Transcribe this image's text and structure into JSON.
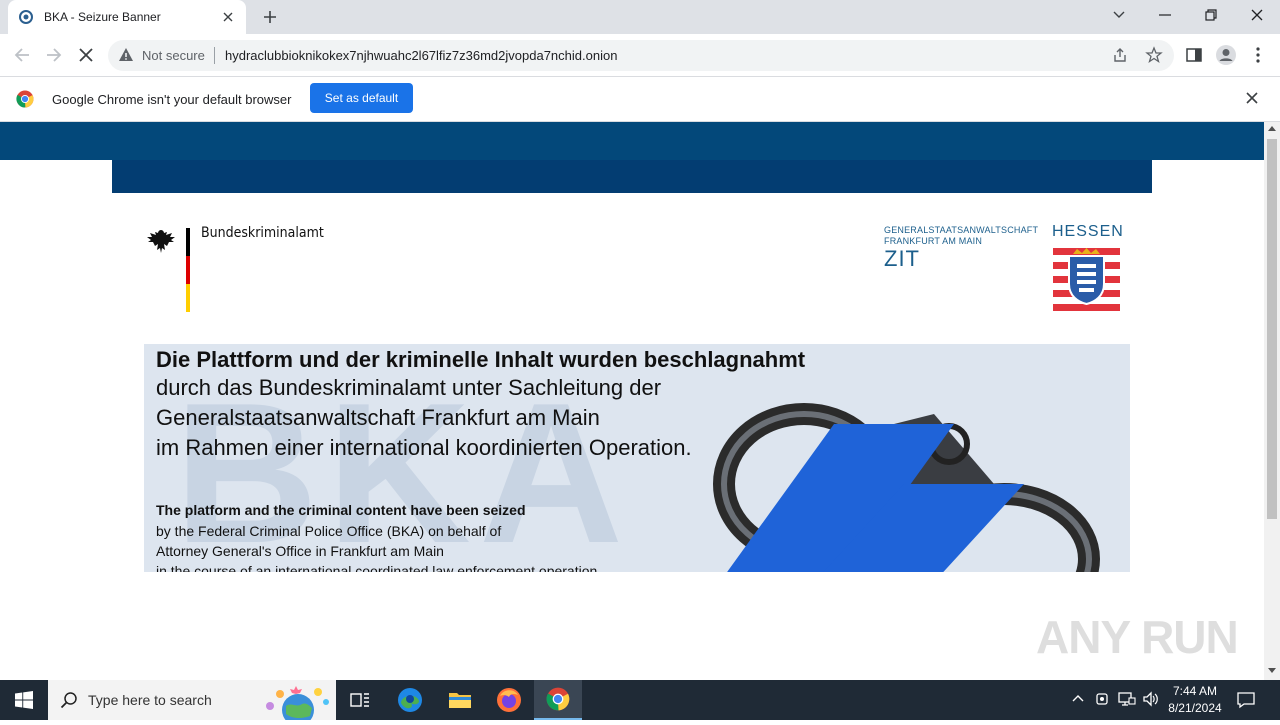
{
  "browser": {
    "tab_title": "BKA - Seizure Banner",
    "security_label": "Not secure",
    "url": "hydraclubbioknikokex7njhwuahc2l67lfiz7z36md2jvopda7nchid.onion"
  },
  "infobar": {
    "message": "Google Chrome isn't your default browser",
    "button_label": "Set as default"
  },
  "page": {
    "bka_name": "Bundeskriminalamt",
    "gsa_line1": "GENERALSTAATSANWALTSCHAFT",
    "gsa_line2": "FRANKFURT AM MAIN",
    "zit": "ZIT",
    "hessen": "HESSEN",
    "banner_watermark": "BKA",
    "de_heading": "Die Plattform und der kriminelle Inhalt wurden beschlagnahmt",
    "de_lines": [
      "durch das Bundeskriminalamt unter Sachleitung der",
      "Generalstaatsanwaltschaft Frankfurt am Main",
      "im Rahmen einer international koordinierten Operation."
    ],
    "en_heading": "The platform and the criminal content have been seized",
    "en_lines": [
      "by the Federal Criminal Police Office (BKA) on behalf of",
      "Attorney General's Office in Frankfurt am Main",
      "in the course of an international coordinated law enforcement operation."
    ]
  },
  "overlay": {
    "watermark": "ANY RUN"
  },
  "taskbar": {
    "search_placeholder": "Type here to search",
    "time": "7:44 AM",
    "date": "8/21/2024"
  },
  "colors": {
    "header_blue": "#03487a",
    "header_blue_dark": "#033d72",
    "zit_blue": "#1c5f8c",
    "accent_blue": "#1a73e8",
    "hessen_red": "#e2343c"
  }
}
